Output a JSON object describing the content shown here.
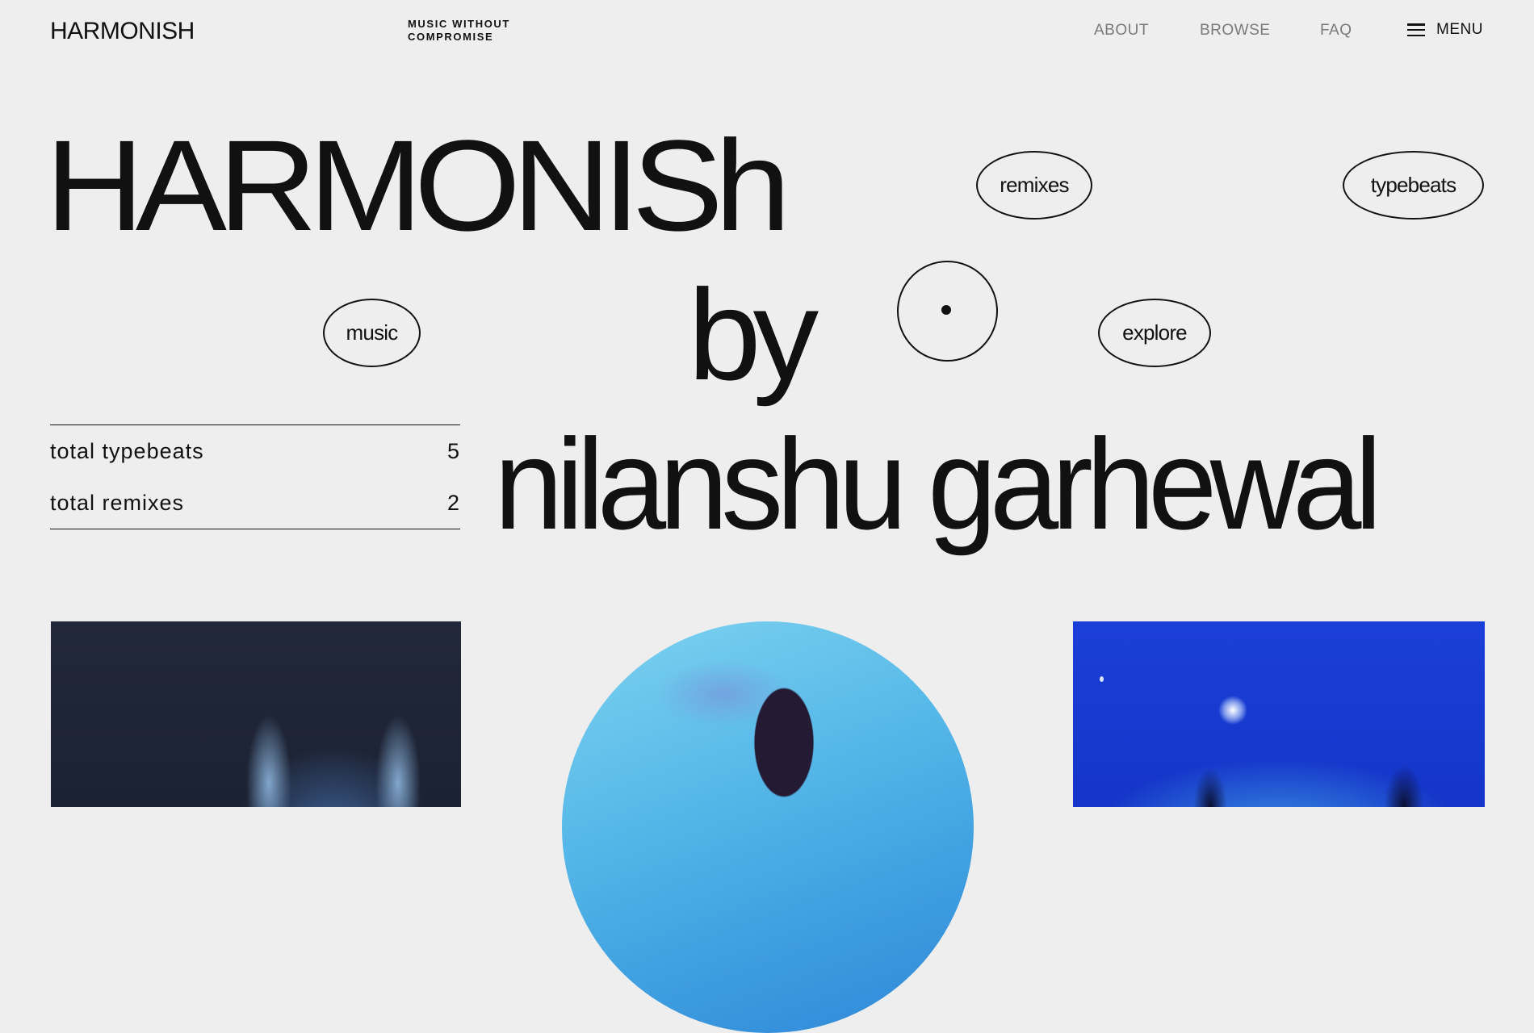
{
  "header": {
    "logo": "HARMONISH",
    "tagline_line1": "MUSIC WITHOUT",
    "tagline_line2": "COMPROMISE",
    "nav": [
      "ABOUT",
      "BROWSE",
      "FAQ"
    ],
    "menu_label": "MENU"
  },
  "hero": {
    "line1": "HARMONISh",
    "line2": "by",
    "line3": "nilanshu garhewal"
  },
  "pills": {
    "remixes": "remixes",
    "typebeats": "typebeats",
    "music": "music",
    "explore": "explore"
  },
  "stats": [
    {
      "label": "total typebeats",
      "value": "5"
    },
    {
      "label": "total remixes",
      "value": "2"
    }
  ]
}
